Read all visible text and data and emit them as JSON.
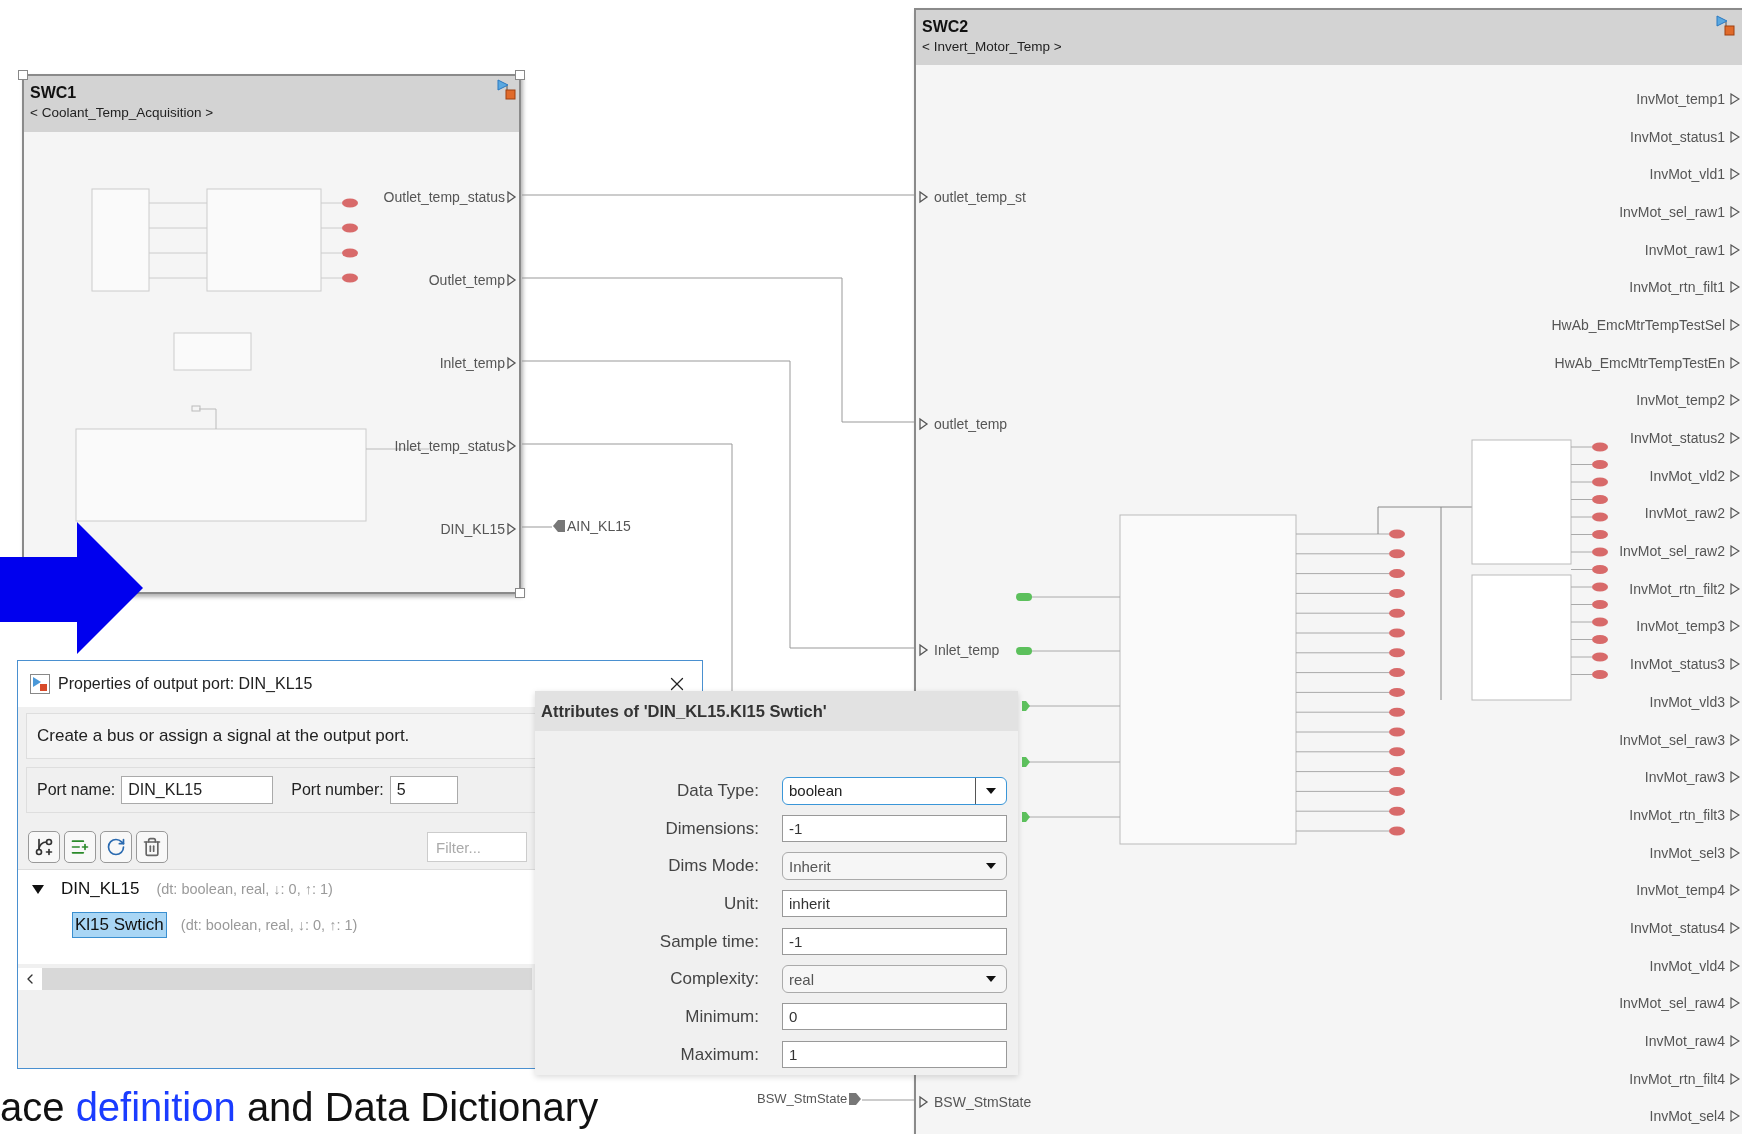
{
  "swc1": {
    "title": "SWC1",
    "subtitle": "< Coolant_Temp_Acquisition >",
    "ports": [
      "Outlet_temp_status",
      "Outlet_temp",
      "Inlet_temp",
      "Inlet_temp_status",
      "DIN_KL15"
    ]
  },
  "goto_tags": [
    {
      "label": "AIN_KL15"
    },
    {
      "label": "BSW_StmState"
    }
  ],
  "swc2": {
    "title": "SWC2",
    "subtitle": "< Invert_Motor_Temp >",
    "input_ports": [
      "outlet_temp_st",
      "outlet_temp",
      "Inlet_temp",
      "BSW_StmState"
    ],
    "output_ports": [
      "InvMot_temp1",
      "InvMot_status1",
      "InvMot_vld1",
      "InvMot_sel_raw1",
      "InvMot_raw1",
      "InvMot_rtn_filt1",
      "HwAb_EmcMtrTempTestSel",
      "HwAb_EmcMtrTempTestEn",
      "InvMot_temp2",
      "InvMot_status2",
      "InvMot_vld2",
      "InvMot_raw2",
      "InvMot_sel_raw2",
      "InvMot_rtn_filt2",
      "InvMot_temp3",
      "InvMot_status3",
      "InvMot_vld3",
      "InvMot_sel_raw3",
      "InvMot_raw3",
      "InvMot_rtn_filt3",
      "InvMot_sel3",
      "InvMot_temp4",
      "InvMot_status4",
      "InvMot_vld4",
      "InvMot_sel_raw4",
      "InvMot_raw4",
      "InvMot_rtn_filt4",
      "InvMot_sel4"
    ]
  },
  "properties_dialog": {
    "title": "Properties of output port: DIN_KL15",
    "description": "Create a bus or assign a signal at the output port.",
    "port_name_label": "Port name:",
    "port_name": "DIN_KL15",
    "port_number_label": "Port number:",
    "port_number": "5",
    "filter_placeholder": "Filter...",
    "tree": [
      {
        "label": "DIN_KL15",
        "info": "(dt: boolean, real, ↓: 0, ↑: 1)",
        "expanded": true,
        "selected": false,
        "children": [
          {
            "label": "Kl15 Swtich",
            "info": "(dt: boolean, real, ↓: 0, ↑: 1)",
            "selected": true
          }
        ]
      }
    ]
  },
  "attributes_panel": {
    "title": "Attributes of 'DIN_KL15.Kl15 Swtich'",
    "fields": [
      {
        "label": "Data Type:",
        "value": "boolean",
        "kind": "combo",
        "focused": true
      },
      {
        "label": "Dimensions:",
        "value": "-1",
        "kind": "text",
        "focused": false
      },
      {
        "label": "Dims Mode:",
        "value": "Inherit",
        "kind": "combo",
        "focused": false
      },
      {
        "label": "Unit:",
        "value": "inherit",
        "kind": "text",
        "focused": false
      },
      {
        "label": "Sample time:",
        "value": "-1",
        "kind": "text",
        "focused": false
      },
      {
        "label": "Complexity:",
        "value": "real",
        "kind": "combo",
        "focused": false
      },
      {
        "label": "Minimum:",
        "value": "0",
        "kind": "text",
        "focused": false
      },
      {
        "label": "Maximum:",
        "value": "1",
        "kind": "text",
        "focused": false
      }
    ]
  },
  "caption": {
    "text_before": "ace",
    "link": "definition",
    "text_after": "and Data Dictionary"
  }
}
